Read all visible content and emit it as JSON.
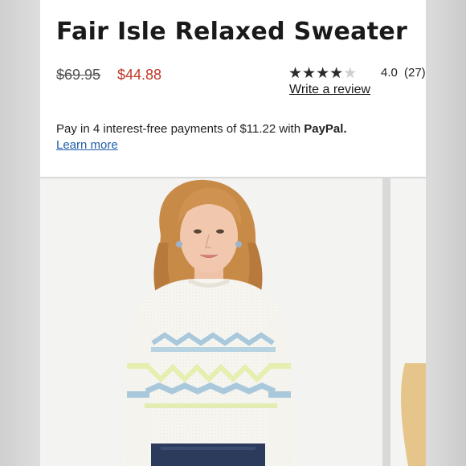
{
  "product": {
    "title": "Fair Isle Relaxed Sweater",
    "original_price": "$69.95",
    "sale_price": "$44.88",
    "rating": {
      "stars_filled": 4,
      "stars_total": 5,
      "value": "4.0",
      "count": "(27)"
    },
    "write_review_label": "Write a review",
    "payment": {
      "text_prefix": "Pay in 4 interest-free payments of $11.22 with",
      "brand": "PayPal.",
      "learn_more_label": "Learn more"
    }
  },
  "colors": {
    "sale": "#c0392b",
    "link": "#1f5fa8",
    "star_filled": "#2b2b2b",
    "star_empty": "#cfcfcf"
  }
}
